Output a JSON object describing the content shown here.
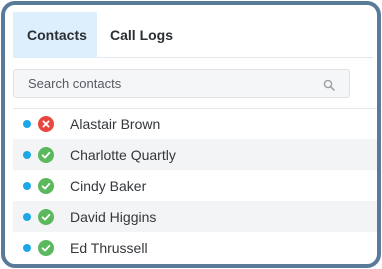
{
  "tabs": [
    {
      "label": "Contacts",
      "active": true
    },
    {
      "label": "Call Logs",
      "active": false
    }
  ],
  "search": {
    "placeholder": "Search contacts",
    "value": "",
    "icon": "search-icon"
  },
  "contacts": [
    {
      "name": "Alastair Brown",
      "presence": "online",
      "status": "unavailable"
    },
    {
      "name": "Charlotte Quartly",
      "presence": "online",
      "status": "available"
    },
    {
      "name": "Cindy Baker",
      "presence": "online",
      "status": "available"
    },
    {
      "name": "David Higgins",
      "presence": "online",
      "status": "available"
    },
    {
      "name": "Ed Thrussell",
      "presence": "online",
      "status": "available"
    }
  ],
  "colors": {
    "frame": "#5a7a99",
    "active_tab": "#ddeefc",
    "presence_dot": "#1ea7e6",
    "available": "#5cb85c",
    "unavailable": "#e8473f"
  }
}
